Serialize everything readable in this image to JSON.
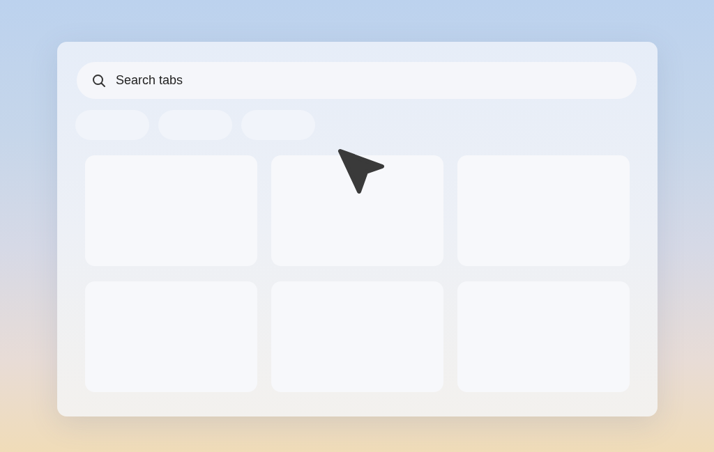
{
  "search": {
    "placeholder": "Search tabs"
  },
  "filter_chips": [
    {
      "kind": "chip"
    },
    {
      "kind": "chip"
    },
    {
      "kind": "chip"
    }
  ],
  "tab_cards": [
    {
      "kind": "card"
    },
    {
      "kind": "card"
    },
    {
      "kind": "card"
    },
    {
      "kind": "card"
    },
    {
      "kind": "card"
    },
    {
      "kind": "card"
    }
  ]
}
